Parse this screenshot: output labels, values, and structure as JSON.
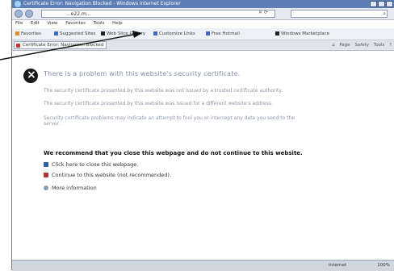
{
  "window": {
    "title": "Certificate Error: Navigation Blocked - Windows Internet Explorer"
  },
  "addressbar": {
    "url": "...e22.m...",
    "search_placeholder": ""
  },
  "menubar": {
    "items": [
      "File",
      "Edit",
      "View",
      "Favorites",
      "Tools",
      "Help"
    ]
  },
  "favorites": {
    "label": "Favorites",
    "items": [
      "Suggested Sites",
      "Web Slice Gallery",
      "Customize Links",
      "Free Hotmail",
      "Windows Marketplace"
    ]
  },
  "tab": {
    "label": "Certificate Error: Navigation Blocked"
  },
  "command_bar": {
    "items": [
      "Page",
      "Safety",
      "Tools"
    ]
  },
  "content": {
    "heading": "There is a problem with this website's security certificate.",
    "para1": "The security certificate presented by this website was not issued by a trusted certificate authority.",
    "para2": "The security certificate presented by this website was issued for a different website's address.",
    "para3": "Security certificate problems may indicate an attempt to fool you or intercept any data you send to the server.",
    "recommendation": "We recommend that you close this webpage and do not continue to this website.",
    "choices": {
      "close": "Click here to close this webpage.",
      "continue": "Continue to this website (not recommended).",
      "more": "More information"
    }
  },
  "statusbar": {
    "zone": "Internet",
    "zoom": "100%"
  },
  "colors": {
    "titlebar": "#5d7fb6",
    "heading": "#7f8fa8",
    "recommendation": "#111111"
  }
}
